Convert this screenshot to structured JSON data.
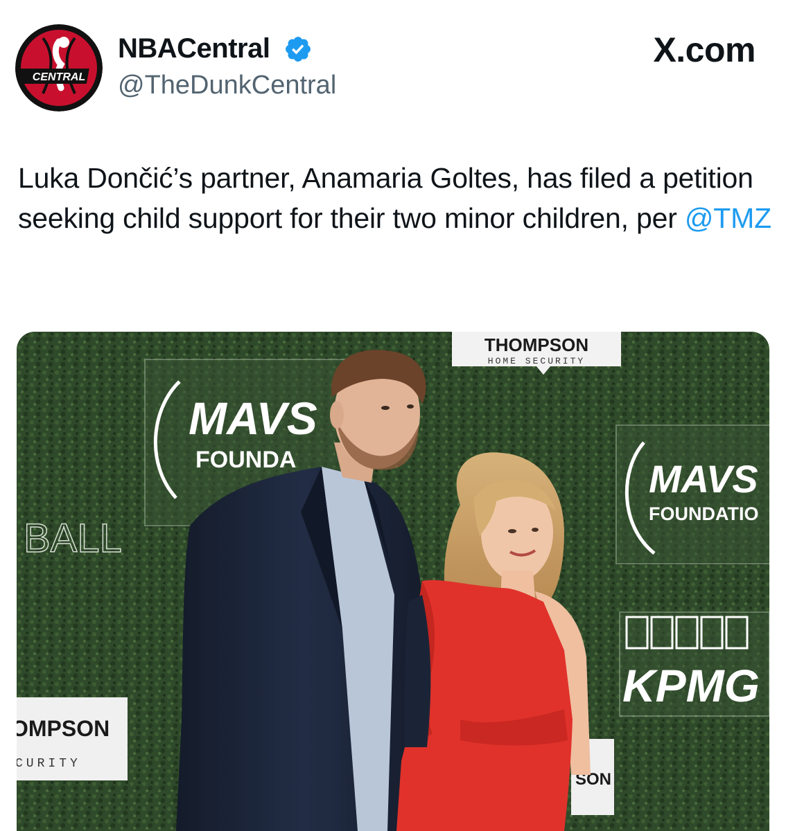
{
  "account": {
    "display_name": "NBACentral",
    "handle": "@TheDunkCentral",
    "avatar_text": "CENTRAL",
    "verified": true,
    "verified_icon": "verified-badge-icon"
  },
  "site_label": "X.com",
  "tweet": {
    "text_before": "Luka Dončić’s partner, Anamaria Goltes, has filed a petition seeking child support for their two minor children, per ",
    "mention": "@TMZ"
  },
  "photo": {
    "backdrop_text": {
      "mavs_1": "MAVS",
      "foundation_1": "FOUNDA",
      "mavs_2": "MAVS",
      "foundation_2": "FOUNDATIO",
      "thompson_top": "THOMPSON",
      "home_security": "HOME SECURITY",
      "ball": "BALL",
      "kpmg": "KPMG",
      "ompson_left": "OMPSON",
      "curity_left": "CURITY",
      "son_right": "SON"
    },
    "colors": {
      "backdrop": "#2f4a2a",
      "suit": "#1b2436",
      "dress": "#e0322b"
    }
  },
  "colors": {
    "text": "#0f1419",
    "secondary": "#536471",
    "link": "#1d9bf0",
    "verified": "#1d9bf0"
  }
}
